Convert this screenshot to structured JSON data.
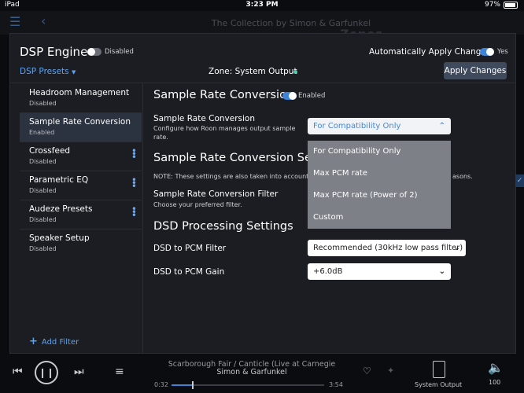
{
  "status_bar": {
    "device": "iPad",
    "time": "3:23 PM",
    "battery": "97%"
  },
  "background": {
    "header_title": "The Collection by Simon & Garfunkel",
    "zones_label": "Zones"
  },
  "dsp": {
    "title": "DSP Engine",
    "engine_toggle": "Disabled",
    "auto_apply_label": "Automatically Apply Changes",
    "auto_apply_value": "Yes",
    "presets_label": "DSP Presets",
    "zone_label": "Zone: System Output",
    "apply_button": "Apply Changes"
  },
  "sidebar": {
    "items": [
      {
        "name": "Headroom Management",
        "status": "Disabled"
      },
      {
        "name": "Sample Rate Conversion",
        "status": "Enabled"
      },
      {
        "name": "Crossfeed",
        "status": "Disabled"
      },
      {
        "name": "Parametric EQ",
        "status": "Disabled"
      },
      {
        "name": "Audeze Presets",
        "status": "Disabled"
      },
      {
        "name": "Speaker Setup",
        "status": "Disabled"
      }
    ],
    "add_filter": "Add Filter"
  },
  "main": {
    "src_title": "Sample Rate Conversion",
    "src_toggle": "Enabled",
    "src_label": "Sample Rate Conversion",
    "src_desc": "Configure how Roon manages output sample rate.",
    "src_selected": "For Compatibility Only",
    "settings_title": "Sample Rate Conversion Settings",
    "settings_note": "NOTE: These settings are also taken into account whe",
    "settings_note_tail": "asons.",
    "filter_label": "Sample Rate Conversion Filter",
    "filter_desc": "Choose your preferred filter.",
    "dsd_title": "DSD Processing Settings",
    "dsd_filter_label": "DSD to PCM Filter",
    "dsd_filter_value": "Recommended (30kHz low pass filter)",
    "dsd_gain_label": "DSD to PCM Gain",
    "dsd_gain_value": "+6.0dB"
  },
  "dropdown_options": [
    "For Compatibility Only",
    "Max PCM rate",
    "Max PCM rate (Power of 2)",
    "Custom"
  ],
  "player": {
    "track": "Scarborough Fair / Canticle (Live at Carnegie",
    "artist": "Simon & Garfunkel",
    "elapsed": "0:32",
    "duration": "3:54",
    "progress": 0.136,
    "zone": "System Output",
    "volume": "100"
  },
  "colors": {
    "accent": "#3d83d8",
    "link": "#5fa3f0",
    "zone_dot": "#4ccfb0"
  }
}
